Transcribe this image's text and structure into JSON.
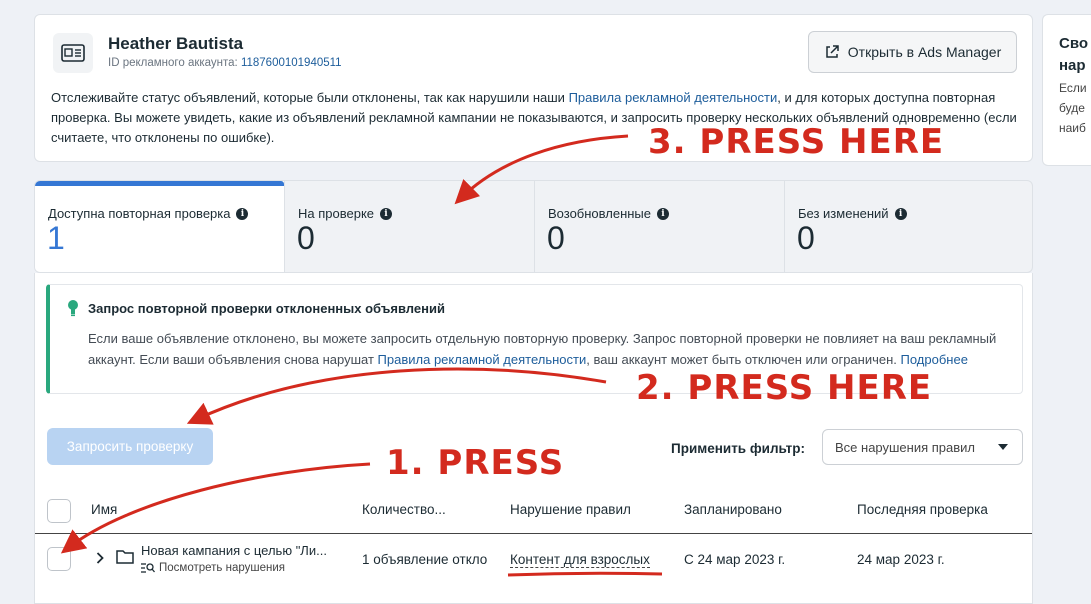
{
  "account": {
    "name": "Heather Bautista",
    "id_label": "ID рекламного аккаунта:",
    "id_value": "1187600101940511",
    "open_button": "Открыть в Ads Manager",
    "description_1": "Отслеживайте статус объявлений, которые были отклонены, так как нарушили наши ",
    "description_link": "Правила рекламной деятельности",
    "description_2": ", и для которых доступна повторная проверка. Вы можете увидеть, какие из объявлений рекламной кампании не показываются, и запросить проверку нескольких объявлений одновременно (если считаете, что отклонены по ошибке)."
  },
  "side_panel": {
    "title_1": "Сво",
    "title_2": "нар",
    "line_1": "Если",
    "line_2": "буде",
    "line_3": "наиб"
  },
  "tabs": [
    {
      "label": "Доступна повторная проверка",
      "count": "1"
    },
    {
      "label": "На проверке",
      "count": "0"
    },
    {
      "label": "Возобновленные",
      "count": "0"
    },
    {
      "label": "Без изменений",
      "count": "0"
    }
  ],
  "notice": {
    "title": "Запрос повторной проверки отклоненных объявлений",
    "text_1": "Если ваше объявление отклонено, вы можете запросить отдельную повторную проверку. Запрос повторной проверки не повлияет на ваш рекламный аккаунт. Если ваши объявления снова нарушат ",
    "text_link": "Правила рекламной деятельности",
    "text_2": ", ваш аккаунт может быть отключен или ограничен. ",
    "more_link": "Подробнее"
  },
  "toolbar": {
    "request_button": "Запросить проверку",
    "filter_label": "Применить фильтр:",
    "filter_value": "Все нарушения правил"
  },
  "table": {
    "headers": [
      "Имя",
      "Количество...",
      "Нарушение правил",
      "Запланировано",
      "Последняя проверка"
    ],
    "rows": [
      {
        "name": "Новая кампания с целью \"Ли...",
        "sub": "Посмотреть нарушения",
        "count": "1 объявление откло",
        "violation": "Контент для взрослых",
        "scheduled": "С 24 мар 2023 г.",
        "last_check": "24 мар 2023 г."
      }
    ]
  },
  "annotations": {
    "step1": "1. PRESS",
    "step2": "2. PRESS HERE",
    "step3": "3. PRESS HERE"
  },
  "colors": {
    "accent": "#3577d4",
    "annotation": "#d32a1e",
    "notice_border": "#2aa87e",
    "link": "#1d5d9b"
  }
}
